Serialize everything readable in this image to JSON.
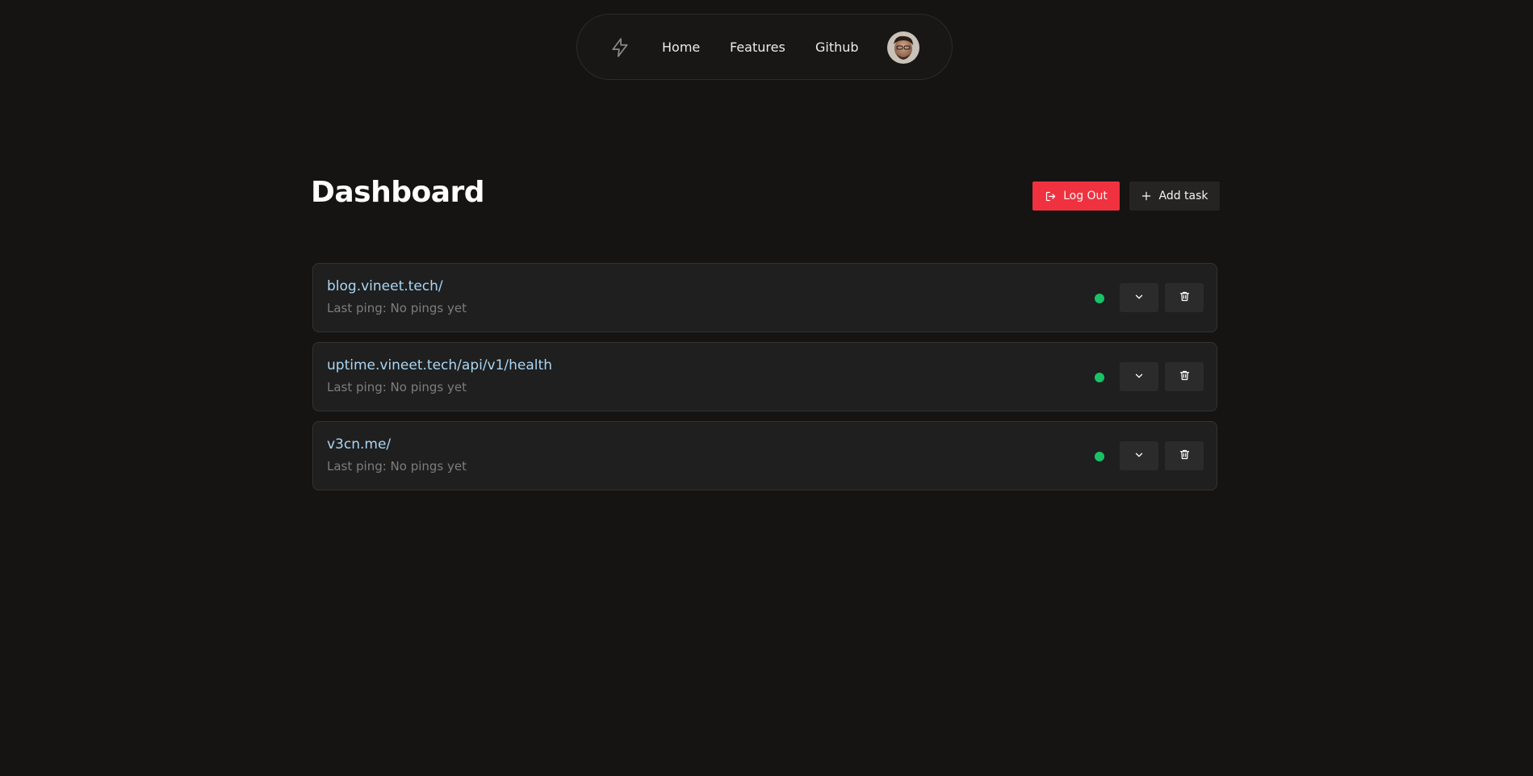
{
  "nav": {
    "logo_icon": "lightning-bolt-icon",
    "links": [
      "Home",
      "Features",
      "Github"
    ],
    "avatar": "user-avatar"
  },
  "dashboard": {
    "title": "Dashboard",
    "logout_label": "Log Out",
    "logout_icon": "logout-icon",
    "add_task_label": "Add task",
    "add_task_icon": "plus-icon"
  },
  "tasks": [
    {
      "url": "blog.vineet.tech/",
      "last_ping": "Last ping: No pings yet",
      "status": "up"
    },
    {
      "url": "uptime.vineet.tech/api/v1/health",
      "last_ping": "Last ping: No pings yet",
      "status": "up"
    },
    {
      "url": "v3cn.me/",
      "last_ping": "Last ping: No pings yet",
      "status": "up"
    }
  ],
  "colors": {
    "background": "#151413",
    "accent_danger": "#f0313f",
    "status_up": "#19c266",
    "link": "#a9d6f5"
  }
}
